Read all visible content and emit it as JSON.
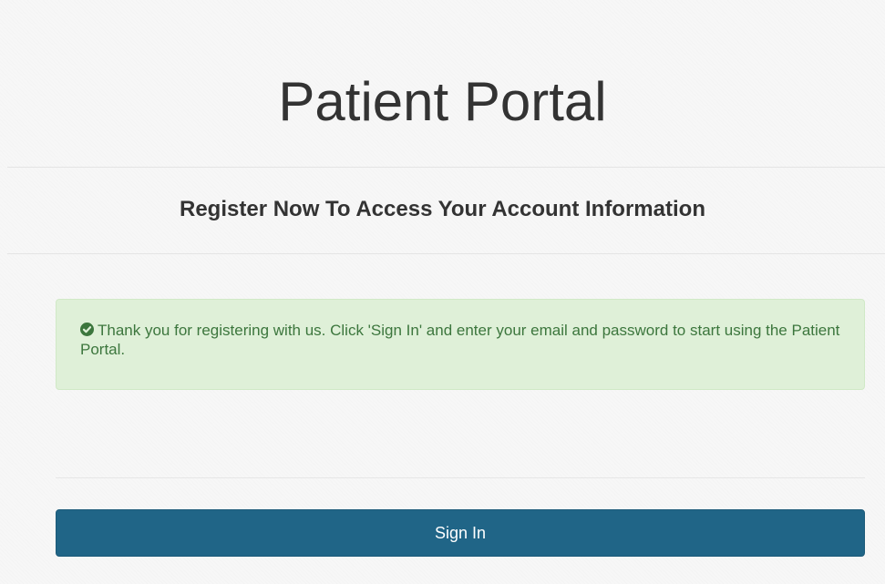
{
  "header": {
    "title": "Patient Portal",
    "subtitle": "Register Now To Access Your Account Information"
  },
  "alert": {
    "icon": "check-circle-icon",
    "message": "Thank you for registering with us. Click 'Sign In' and enter your email and password to start using the Patient Portal.",
    "colors": {
      "background": "#dff0d8",
      "text": "#3c763d"
    }
  },
  "actions": {
    "sign_in_label": "Sign In",
    "button_color": "#206587"
  }
}
